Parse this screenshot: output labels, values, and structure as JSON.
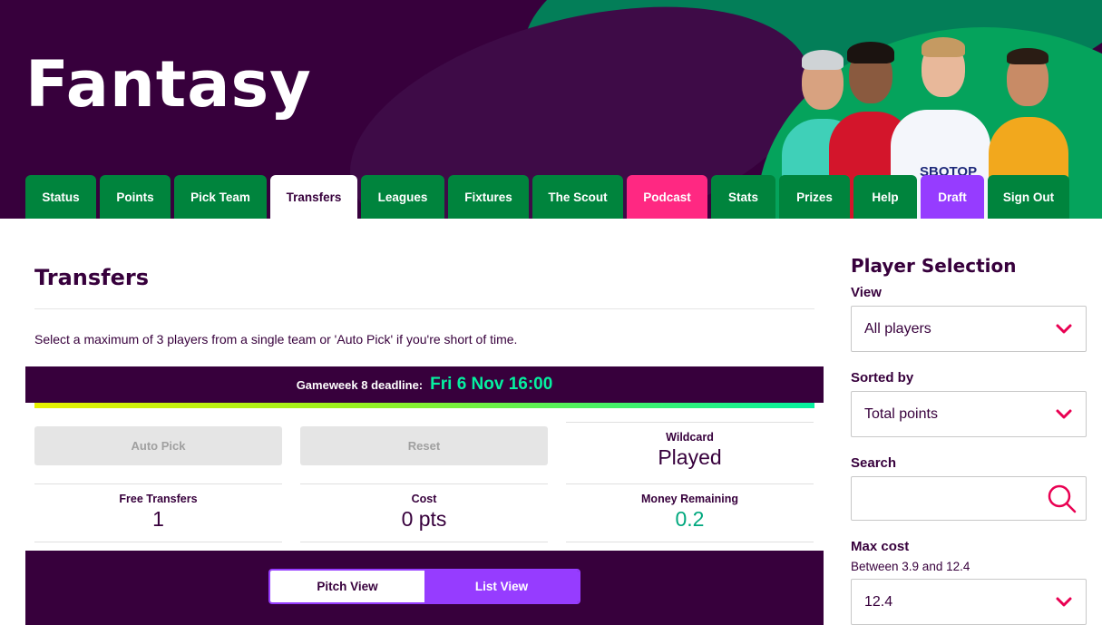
{
  "header": {
    "logo": "Fantasy",
    "sponsor_shirt": "SBOTOP"
  },
  "nav": {
    "tabs": [
      {
        "label": "Status"
      },
      {
        "label": "Points"
      },
      {
        "label": "Pick Team"
      },
      {
        "label": "Transfers",
        "active": true
      },
      {
        "label": "Leagues"
      },
      {
        "label": "Fixtures"
      },
      {
        "label": "The Scout"
      },
      {
        "label": "Podcast"
      },
      {
        "label": "Stats"
      },
      {
        "label": "Prizes"
      },
      {
        "label": "Help"
      },
      {
        "label": "Draft"
      },
      {
        "label": "Sign Out"
      }
    ]
  },
  "main": {
    "title": "Transfers",
    "intro": "Select a maximum of 3 players from a single team or 'Auto Pick' if you're short of time.",
    "deadline_label": "Gameweek 8 deadline:",
    "deadline_value": "Fri 6 Nov 16:00",
    "auto_pick_label": "Auto Pick",
    "reset_label": "Reset",
    "wildcard": {
      "label": "Wildcard",
      "value": "Played"
    },
    "free_transfers": {
      "label": "Free Transfers",
      "value": "1"
    },
    "cost": {
      "label": "Cost",
      "value": "0 pts"
    },
    "money_remaining": {
      "label": "Money Remaining",
      "value": "0.2"
    },
    "view_toggle": {
      "pitch": "Pitch View",
      "list": "List View",
      "selected": "Pitch View"
    }
  },
  "sidebar": {
    "title": "Player Selection",
    "view_label": "View",
    "view_value": "All players",
    "sorted_label": "Sorted by",
    "sorted_value": "Total points",
    "search_label": "Search",
    "search_value": "",
    "max_cost_label": "Max cost",
    "max_cost_range": "Between 3.9 and 12.4",
    "max_cost_value": "12.4"
  },
  "colors": {
    "brand_purple": "#37003c",
    "nav_green": "#00843d",
    "podcast_pink": "#ff2882",
    "draft_violet": "#963cff",
    "deadline_green": "#05f0a0",
    "accent_pink": "#e90052"
  }
}
